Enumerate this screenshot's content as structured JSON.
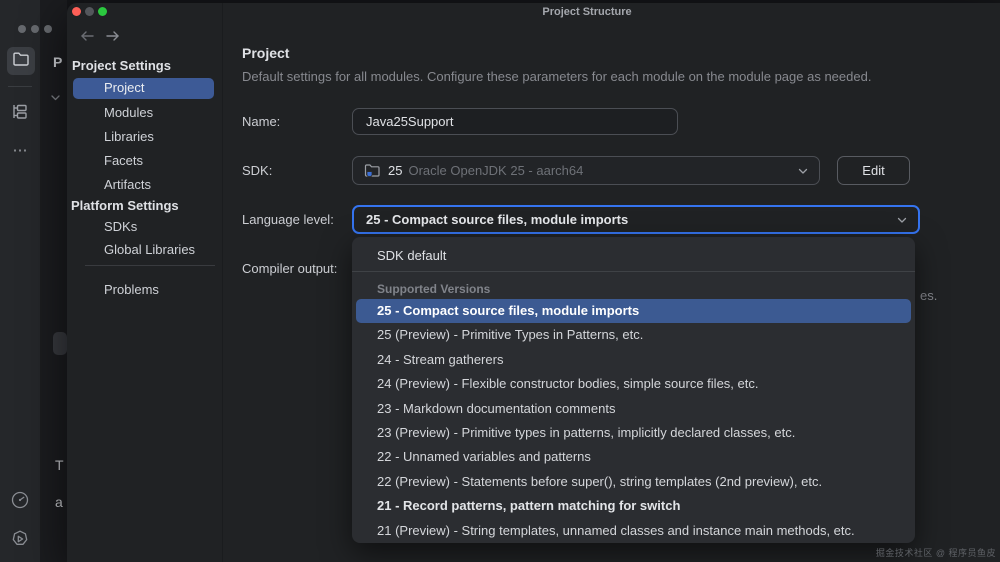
{
  "colors": {
    "accent_blue": "#3574F0",
    "selection_blue": "#3C5A92",
    "traffic_close_red": "#FE5F57",
    "traffic_zoom_green": "#2BC93F",
    "traffic_minimize_disabled": "#54575C"
  },
  "icons": {
    "more": "⋯",
    "toolbar": [
      "folder-icon",
      "structure-icon",
      "more-icon",
      "profiler-gauge-icon",
      "services-play-icon"
    ]
  },
  "ide": {
    "fragments": {
      "p": "P",
      "t": "T",
      "a": "a"
    }
  },
  "dialog": {
    "title": "Project Structure",
    "nav": {
      "sections": [
        {
          "header": "Project Settings",
          "items": [
            "Project",
            "Modules",
            "Libraries",
            "Facets",
            "Artifacts"
          ]
        },
        {
          "header": "Platform Settings",
          "items": [
            "SDKs",
            "Global Libraries"
          ]
        }
      ],
      "bottom_item": "Problems",
      "selected_item": "Project"
    },
    "content": {
      "heading": "Project",
      "description": "Default settings for all modules. Configure these parameters for each module on the module page as needed.",
      "name_field": {
        "label": "Name:",
        "value": "Java25Support"
      },
      "sdk_field": {
        "label": "SDK:",
        "version": "25",
        "sdk_name": "Oracle OpenJDK 25 - aarch64",
        "edit_button": "Edit"
      },
      "language_level_field": {
        "label": "Language level:",
        "value": "25 - Compact source files, module imports"
      },
      "compiler_output_field": {
        "label": "Compiler output:"
      },
      "obscured_text_fragment": "es."
    },
    "dropdown": {
      "default_item": "SDK default",
      "group_header": "Supported Versions",
      "selected_index": 0,
      "items": [
        "25 - Compact source files, module imports",
        "25 (Preview) - Primitive Types in Patterns, etc.",
        "24 - Stream gatherers",
        "24 (Preview) - Flexible constructor bodies, simple source files, etc.",
        "23 - Markdown documentation comments",
        "23 (Preview) - Primitive types in patterns, implicitly declared classes, etc.",
        "22 - Unnamed variables and patterns",
        "22 (Preview) - Statements before super(), string templates (2nd preview), etc.",
        "21 - Record patterns, pattern matching for switch",
        "21 (Preview) - String templates, unnamed classes and instance main methods, etc."
      ]
    }
  },
  "watermark": "掘金技术社区 @ 程序员鱼皮"
}
